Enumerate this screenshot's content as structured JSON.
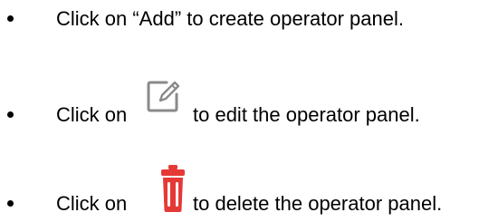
{
  "instructions": {
    "items": [
      {
        "text": "Click on “Add” to create operator panel."
      },
      {
        "before": "Click on",
        "icon": "edit-icon",
        "after": "to edit the operator panel."
      },
      {
        "before": "Click on",
        "icon": "delete-icon",
        "after": "to delete the operator panel."
      }
    ]
  },
  "colors": {
    "edit_icon": "#8a8a8a",
    "delete_icon": "#e53935"
  }
}
